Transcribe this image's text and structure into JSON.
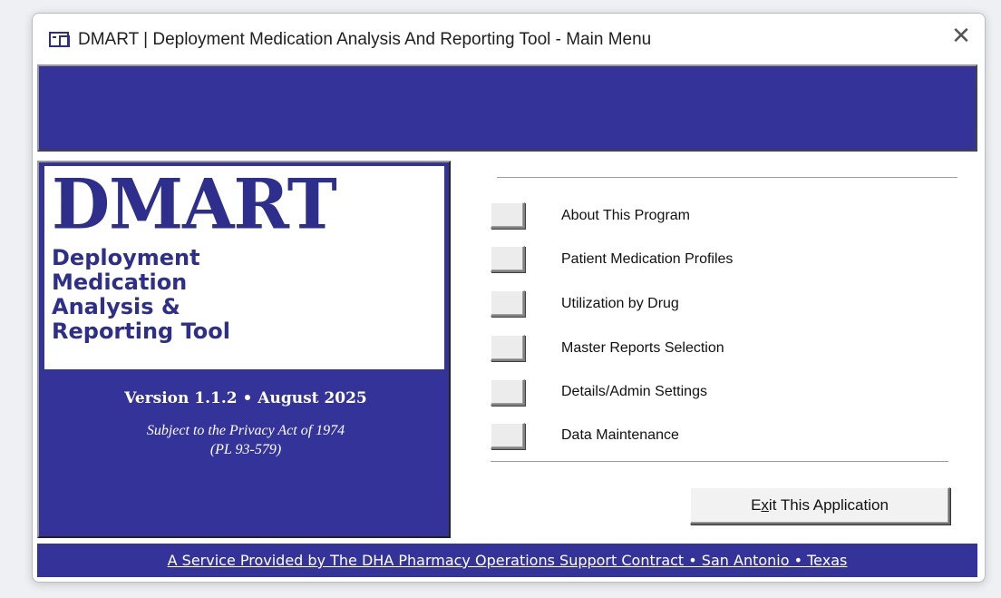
{
  "window": {
    "title": "DMART | Deployment Medication Analysis And Reporting Tool - Main Menu",
    "close_glyph": "✕",
    "icon": "form-window-icon"
  },
  "logo": {
    "main": "DMART",
    "sub": "Deployment\nMedication\nAnalysis &\nReporting Tool"
  },
  "info": {
    "version": "Version 1.1.2 • August 2025",
    "privacy": "Subject to the Privacy Act of 1974\n(PL 93-579)"
  },
  "menu": {
    "items": [
      {
        "label": "About This Program"
      },
      {
        "label": "Patient Medication Profiles"
      },
      {
        "label": "Utilization by Drug"
      },
      {
        "label": "Master Reports Selection"
      },
      {
        "label": "Details/Admin Settings"
      },
      {
        "label": "Data Maintenance"
      }
    ],
    "exit": {
      "before": "E",
      "mnemonic": "x",
      "after": "it This Application"
    }
  },
  "footer": {
    "text": "A Service Provided by The DHA Pharmacy Operations Support Contract  •  San Antonio  •  Texas"
  },
  "colors": {
    "brand_navy": "#333399",
    "logo_text": "#2e2e8c"
  }
}
